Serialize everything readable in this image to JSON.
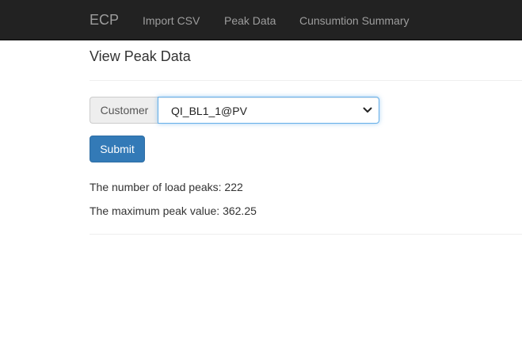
{
  "navbar": {
    "brand": "ECP",
    "links": [
      {
        "label": "Import CSV"
      },
      {
        "label": "Peak Data"
      },
      {
        "label": "Cunsumtion Summary"
      }
    ]
  },
  "page": {
    "title": "View Peak Data"
  },
  "form": {
    "customer_label": "Customer",
    "customer_selected": "QI_BL1_1@PV",
    "submit_label": "Submit"
  },
  "results": {
    "peaks_text": "The number of load peaks: 222",
    "max_text": "The maximum peak value: 362.25"
  },
  "colors": {
    "navbar_bg": "#222222",
    "nav_text": "#9d9d9d",
    "primary": "#337ab7",
    "focus_border": "#66afe9"
  },
  "icons": {
    "select_arrow": "chevron-down-icon"
  }
}
